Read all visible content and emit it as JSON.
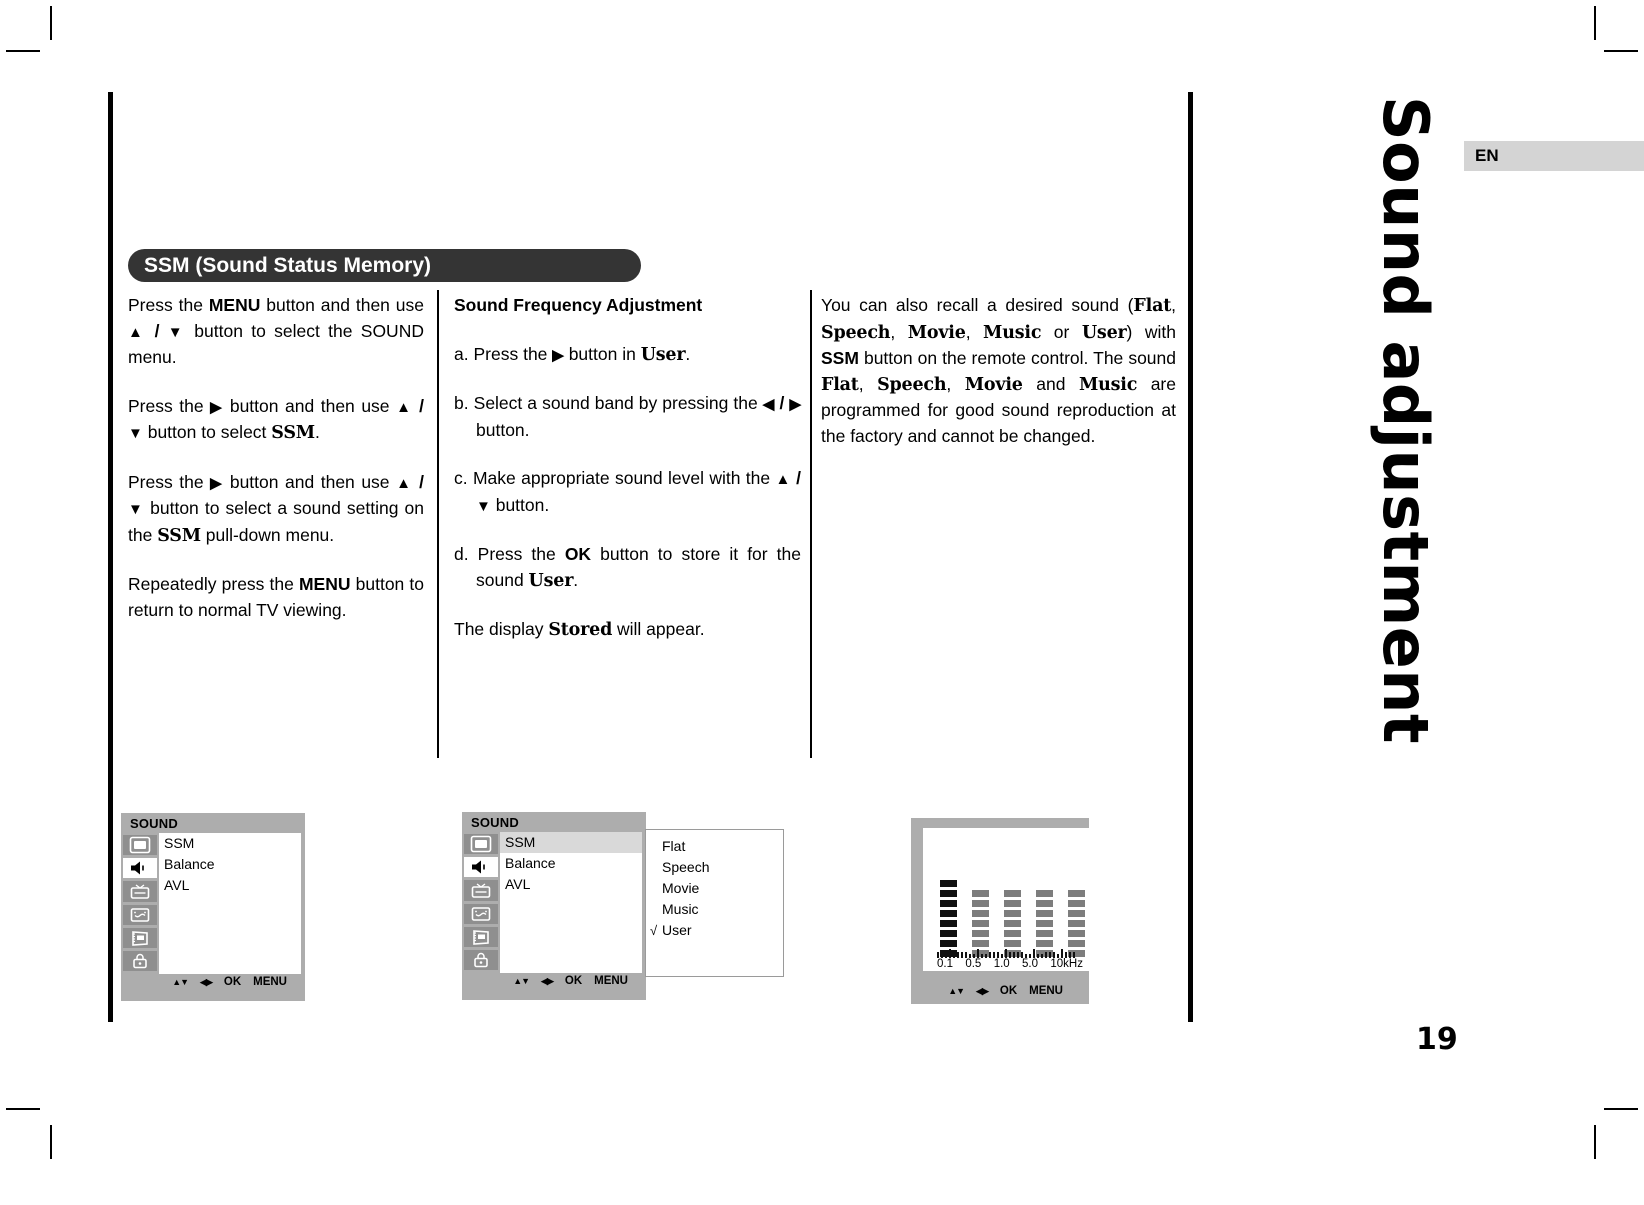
{
  "page": {
    "number": "19",
    "language_badge": "EN",
    "side_title": "Sound adjustment"
  },
  "section": {
    "header": "SSM (Sound Status Memory)"
  },
  "column1": {
    "p1_a": "Press the ",
    "p1_menu": "MENU",
    "p1_b": " button and then use ",
    "p1_up": "▲",
    "p1_slash": " / ",
    "p1_dn": "▼",
    "p1_c": " button to select the SOUND menu.",
    "p2_a": "Press the ",
    "p2_right": "▶",
    "p2_b": " button and then use ",
    "p2_up": "▲",
    "p2_slash": " / ",
    "p2_dn": "▼",
    "p2_c": " button to select ",
    "p2_ssm": "SSM",
    "p2_d": ".",
    "p3_a": "Press the ",
    "p3_right": "▶",
    "p3_b": " button and then use ",
    "p3_up": "▲",
    "p3_slash": " / ",
    "p3_dn": "▼",
    "p3_c": " button to select a sound setting on the ",
    "p3_ssm": "SSM",
    "p3_d": " pull-down menu.",
    "p4_a": "Repeatedly press the ",
    "p4_menu": "MENU",
    "p4_b": " button to return to normal TV viewing."
  },
  "column2": {
    "heading": "Sound Frequency Adjustment",
    "a_label": "a.",
    "a_t1": "Press the ",
    "a_arrow": "▶",
    "a_t2": " button in ",
    "a_user": "User",
    "a_t3": ".",
    "b_label": "b.",
    "b_t1": "Select a sound band by pressing the ",
    "b_left": "◀",
    "b_slash": " / ",
    "b_right": "▶",
    "b_t2": " button.",
    "c_label": "c.",
    "c_t1": "Make appropriate sound level with the ",
    "c_up": "▲",
    "c_slash": " / ",
    "c_dn": "▼",
    "c_t2": " button.",
    "d_label": "d.",
    "d_t1": "Press the ",
    "d_ok": "OK",
    "d_t2": " button to store it for the sound ",
    "d_user": "User",
    "d_t3": ".",
    "e_t1": "The display ",
    "e_stored": "Stored",
    "e_t2": " will appear."
  },
  "column3": {
    "t1": "You can also recall a desired sound (",
    "flat1": "Flat",
    "s1": ", ",
    "speech1": "Speech",
    "s2": ", ",
    "movie1": "Movie",
    "s3": ", ",
    "music1": "Music",
    "t2": " or ",
    "user1": "User",
    "t3": ") with ",
    "ssm": "SSM",
    "t4": " button on the remote control. The sound ",
    "flat2": "Flat",
    "s4": ", ",
    "speech2": "Speech",
    "s5": ", ",
    "movie2": "Movie",
    "t5": " and ",
    "music2": "Music",
    "t6": " are programmed for good sound reproduction at the factory and cannot be changed."
  },
  "osd1": {
    "title": "SOUND",
    "items": [
      "SSM",
      "Balance",
      "AVL"
    ],
    "nav": {
      "updown": "▲▼",
      "leftright": "◀▶",
      "ok": "OK",
      "menu": "MENU"
    },
    "icons": [
      "picture-icon",
      "sound-icon",
      "station-icon",
      "time-icon",
      "special-icon",
      "lock-icon"
    ],
    "active_icon_index": 1
  },
  "osd2": {
    "title": "SOUND",
    "items": [
      "SSM",
      "Balance",
      "AVL"
    ],
    "selected_index": 0,
    "submenu": [
      "Flat",
      "Speech",
      "Movie",
      "Music",
      "User"
    ],
    "submenu_checked_index": 4,
    "check_glyph": "√",
    "nav": {
      "updown": "▲▼",
      "leftright": "◀▶",
      "ok": "OK",
      "menu": "MENU"
    },
    "icons": [
      "picture-icon",
      "sound-icon",
      "station-icon",
      "time-icon",
      "special-icon",
      "lock-icon"
    ],
    "active_icon_index": 1
  },
  "osd3": {
    "nav": {
      "updown": "▲▼",
      "leftright": "◀▶",
      "ok": "OK",
      "menu": "MENU"
    },
    "frequency_labels": [
      "0.1",
      "0.5",
      "1.0",
      "5.0",
      "10kHz"
    ],
    "band_levels": [
      8,
      7,
      7,
      7,
      7
    ],
    "band_active": [
      true,
      false,
      false,
      false,
      false
    ],
    "segments_per_band": 8
  }
}
